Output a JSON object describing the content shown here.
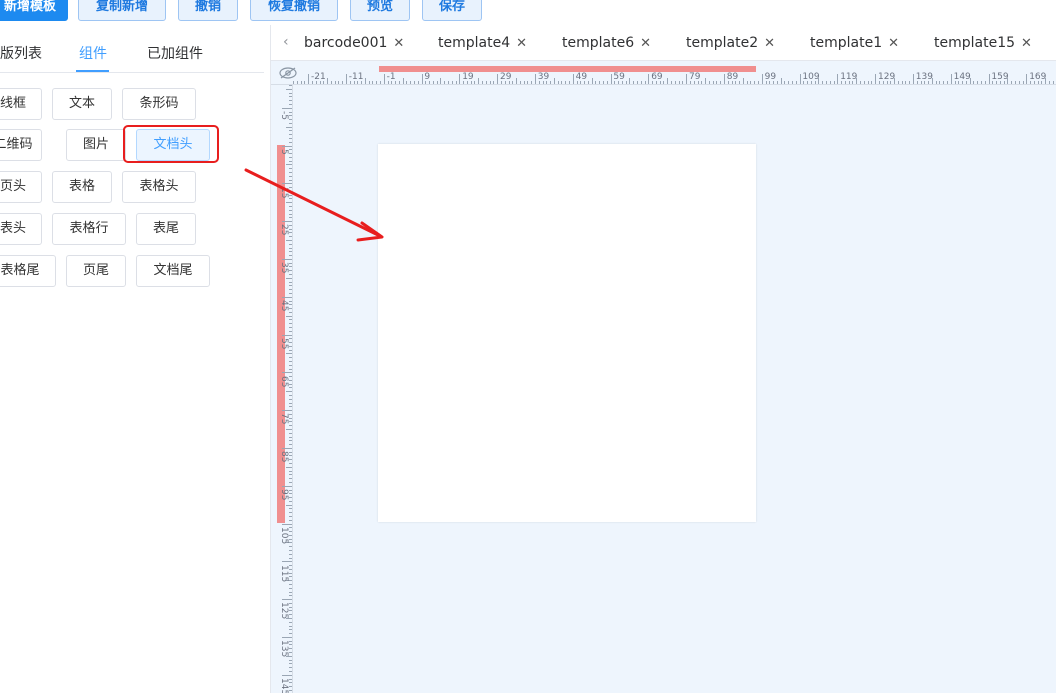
{
  "toolbar": {
    "buttons": [
      "新增模板",
      "复制新增",
      "撤销",
      "恢复撤销",
      "预览",
      "保存"
    ]
  },
  "left": {
    "tabs": [
      "模版列表",
      "组件",
      "已加组件"
    ],
    "active_tab": "组件",
    "components": [
      [
        "线框",
        "文本",
        "条形码"
      ],
      [
        "二维码",
        "图片",
        "文档头"
      ],
      [
        "页头",
        "表格",
        "表格头"
      ],
      [
        "表头",
        "表格行",
        "表尾"
      ],
      [
        "表格尾",
        "页尾",
        "文档尾"
      ]
    ],
    "selected": "文档头"
  },
  "editor_tabs": [
    {
      "label": "barcode001"
    },
    {
      "label": "template4"
    },
    {
      "label": "template6"
    },
    {
      "label": "template2"
    },
    {
      "label": "template1"
    },
    {
      "label": "template15"
    }
  ],
  "ruler_h_labels": [
    "-21",
    "-11",
    "-1",
    "9",
    "19",
    "29",
    "39",
    "49",
    "59",
    "69",
    "79",
    "89",
    "99",
    "109",
    "119",
    "129",
    "139",
    "149",
    "159",
    "169"
  ],
  "ruler_v_labels": [
    "-5",
    "5",
    "15",
    "25",
    "35",
    "45",
    "55",
    "65",
    "75",
    "85",
    "95",
    "105",
    "115",
    "125",
    "135",
    "145"
  ],
  "colors": {
    "primary": "#1d8af0",
    "highlight": "#e81e1e",
    "ruler_mark": "#f08f8f",
    "canvas_bg": "#eef5fd"
  },
  "icons": {
    "ruler_corner": "eye-off-icon",
    "tab_close": "close-icon",
    "tabs_scroll": "chevron-left-icon",
    "annotation": "arrow-icon"
  }
}
